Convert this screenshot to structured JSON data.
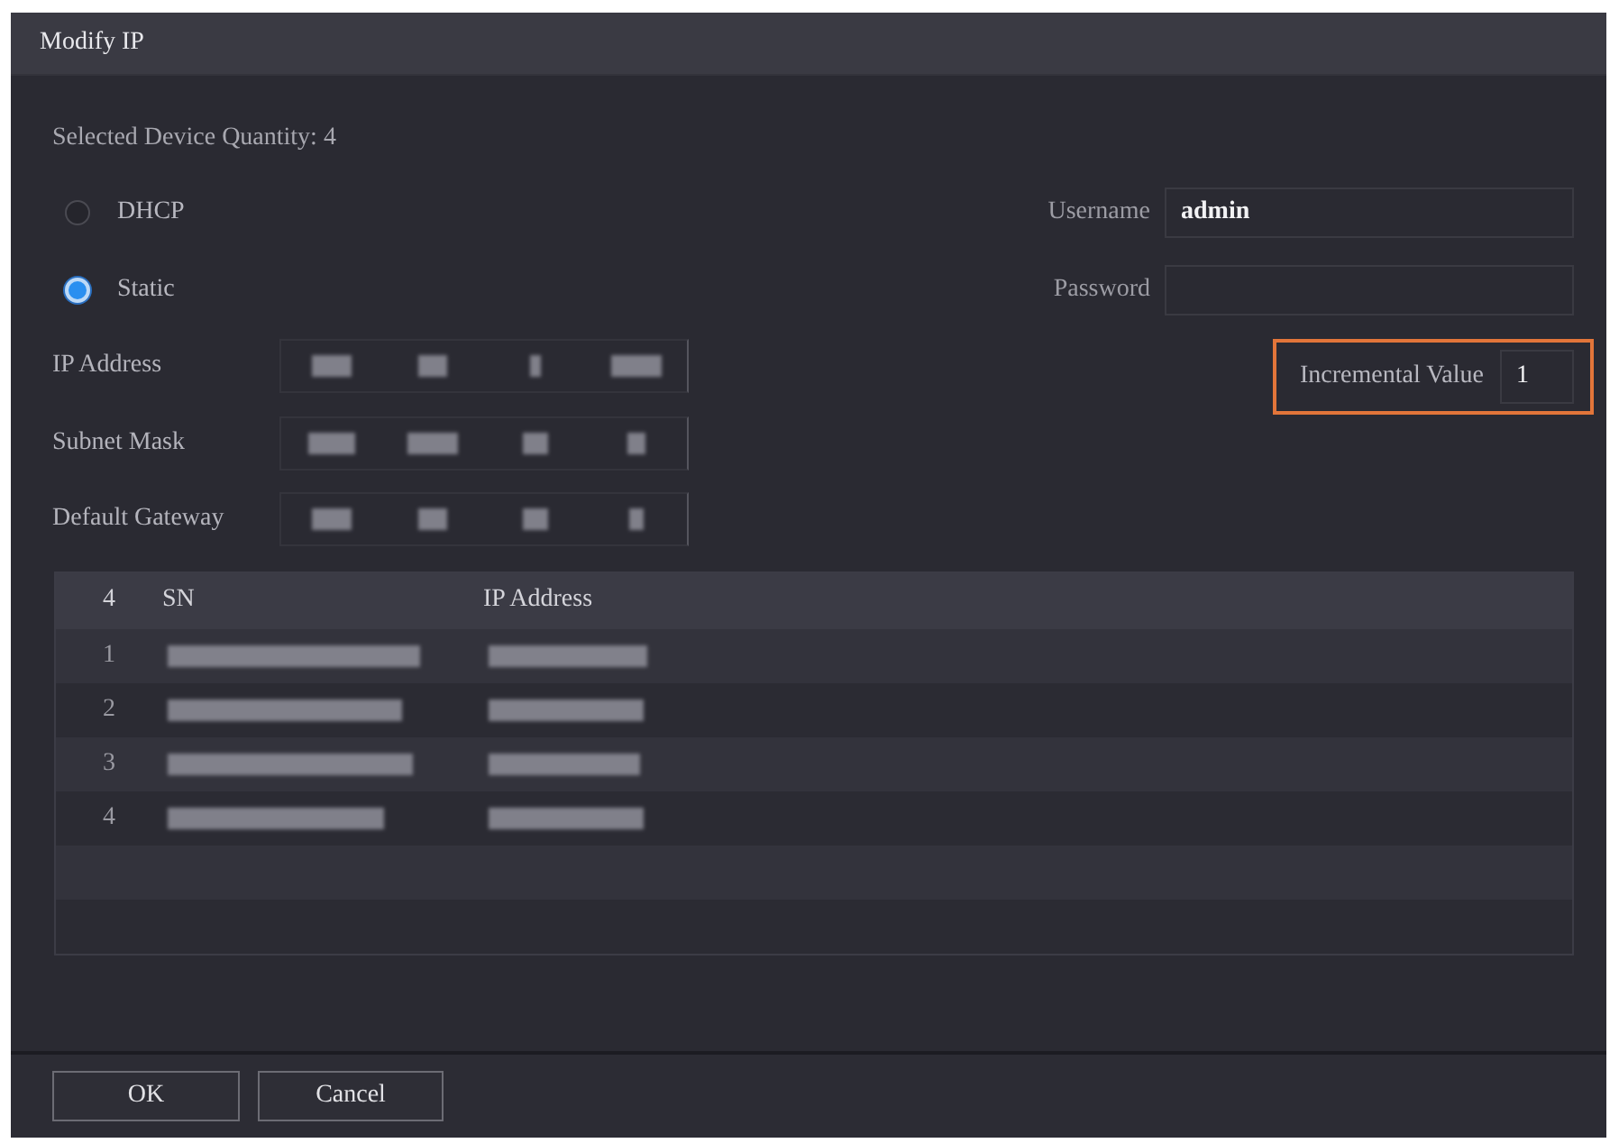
{
  "window": {
    "title": "Modify IP"
  },
  "summary": "Selected Device Quantity: 4",
  "mode_options": [
    {
      "label": "DHCP",
      "selected": false
    },
    {
      "label": "Static",
      "selected": true
    }
  ],
  "ip_fields": [
    {
      "label": "IP Address",
      "redacted": true
    },
    {
      "label": "Subnet Mask",
      "redacted": true
    },
    {
      "label": "Default Gateway",
      "redacted": true
    }
  ],
  "credentials": [
    {
      "label": "Username",
      "value": "admin"
    },
    {
      "label": "Password"
    }
  ],
  "incremental_value": {
    "label": "Incremental Value",
    "value": "1",
    "highlighted": true
  },
  "table": {
    "columns": [
      "4",
      "SN",
      "IP Address"
    ],
    "rows": [
      {
        "index": "1",
        "redacted": true
      },
      {
        "index": "2",
        "redacted": true
      },
      {
        "index": "3",
        "redacted": true
      },
      {
        "index": "4",
        "redacted": true
      }
    ]
  },
  "buttons": [
    "OK",
    "Cancel"
  ]
}
